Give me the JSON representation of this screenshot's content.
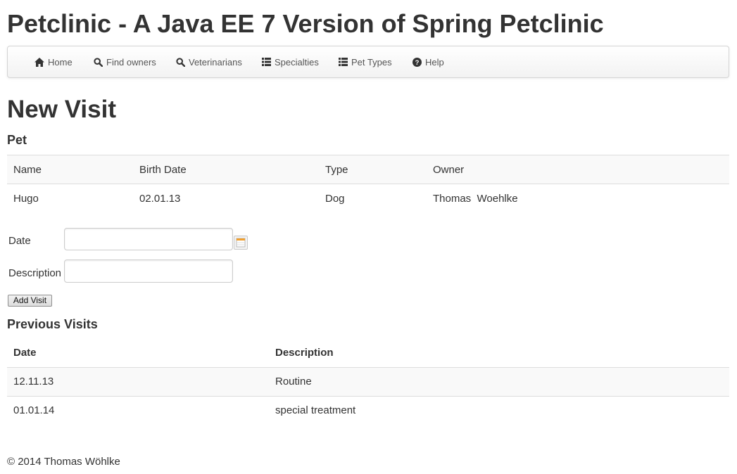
{
  "app": {
    "title": "Petclinic - A Java EE 7 Version of Spring Petclinic"
  },
  "nav": {
    "home": "Home",
    "find_owners": "Find owners",
    "veterinarians": "Veterinarians",
    "specialties": "Specialties",
    "pet_types": "Pet Types",
    "help": "Help"
  },
  "page": {
    "title": "New Visit"
  },
  "pet_section": {
    "title": "Pet",
    "headers": {
      "name": "Name",
      "birth_date": "Birth Date",
      "type": "Type",
      "owner": "Owner"
    },
    "row": {
      "name": "Hugo",
      "birth_date": "02.01.13",
      "type": "Dog",
      "owner": "Thomas  Woehlke"
    }
  },
  "form": {
    "date_label": "Date",
    "date_value": "",
    "description_label": "Description",
    "description_value": "",
    "submit_label": "Add Visit"
  },
  "previous_visits": {
    "title": "Previous Visits",
    "headers": {
      "date": "Date",
      "description": "Description"
    },
    "rows": [
      {
        "date": "12.11.13",
        "description": "Routine"
      },
      {
        "date": "01.01.14",
        "description": "special treatment"
      }
    ]
  },
  "footer": {
    "text": "© 2014 Thomas Wöhlke"
  },
  "icons": [
    "home-icon",
    "search-icon",
    "list-icon",
    "help-icon",
    "calendar-icon"
  ],
  "colors": {
    "text": "#333333",
    "nav_text": "#555555",
    "stripe": "#f9f9f9",
    "border": "#dddddd"
  }
}
